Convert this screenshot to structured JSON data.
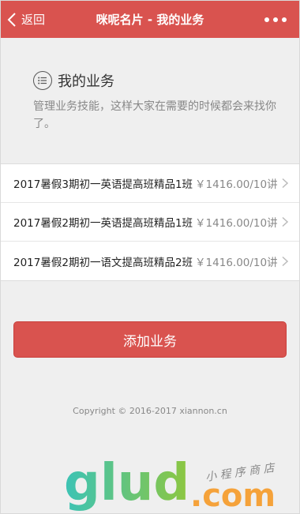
{
  "nav": {
    "back_label": "返回",
    "title": "咪呢名片 - 我的业务"
  },
  "section": {
    "title": "我的业务",
    "description": "管理业务技能，这样大家在需要的时候都会来找你了。"
  },
  "services": [
    {
      "name": "2017暑假3期初一英语提高班精品1班",
      "price": "￥1416.00/10讲"
    },
    {
      "name": "2017暑假2期初一英语提高班精品1班",
      "price": "￥1416.00/10讲"
    },
    {
      "name": "2017暑假2期初一语文提高班精品2班",
      "price": "￥1416.00/10讲"
    }
  ],
  "add_button_label": "添加业务",
  "footer": {
    "copyright": "Copyright © 2016-2017 xiannon.cn"
  },
  "watermark": {
    "logo_text": "glud",
    "domain": ".com",
    "tagline": "小程序商店"
  },
  "colors": {
    "accent": "#d9534f",
    "background": "#efefef"
  }
}
